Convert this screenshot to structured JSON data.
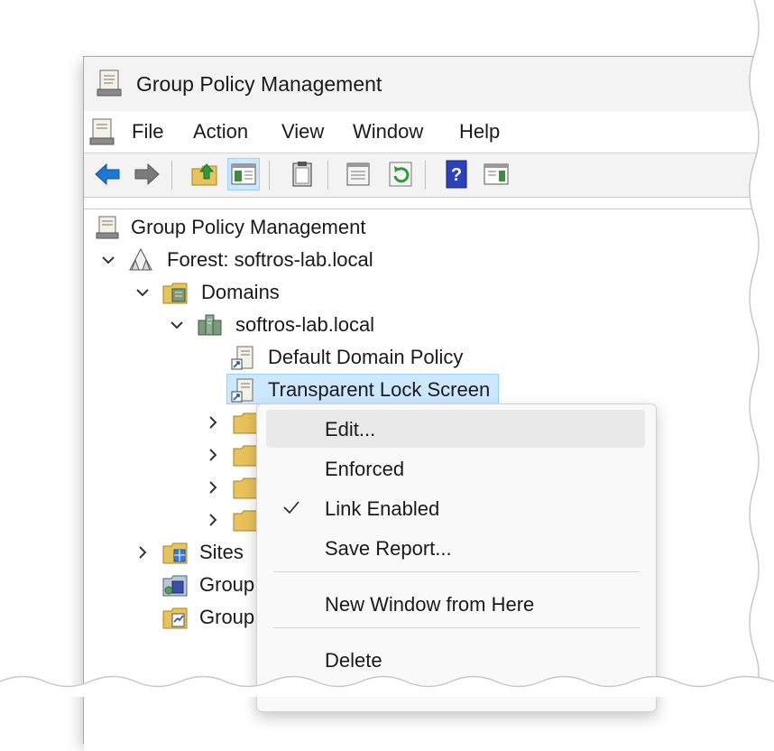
{
  "window": {
    "title": "Group Policy Management"
  },
  "menubar": {
    "items": [
      "File",
      "Action",
      "View",
      "Window",
      "Help"
    ]
  },
  "toolbar": {
    "buttons": [
      "back-arrow-icon",
      "forward-arrow-icon",
      "up-folder-icon",
      "show-hide-console-tree-icon",
      "clipboard-icon",
      "properties-icon",
      "refresh-icon",
      "help-icon",
      "show-action-pane-icon"
    ]
  },
  "tree": {
    "root": "Group Policy Management",
    "forest": "Forest: softros-lab.local",
    "domains": "Domains",
    "domain": "softros-lab.local",
    "gpo_links": [
      "Default Domain Policy",
      "Transparent Lock Screen"
    ],
    "sites": "Sites",
    "group_modeling": "Group",
    "group_results": "Group"
  },
  "context_menu": {
    "items": [
      "Edit...",
      "Enforced",
      "Link Enabled",
      "Save Report...",
      "New Window from Here",
      "Delete"
    ],
    "checked": "Link Enabled",
    "hovered": "Edit..."
  },
  "colors": {
    "selection": "#cce8ff",
    "accent_blue": "#1e78d2",
    "folder_yellow": "#e8c25a"
  }
}
